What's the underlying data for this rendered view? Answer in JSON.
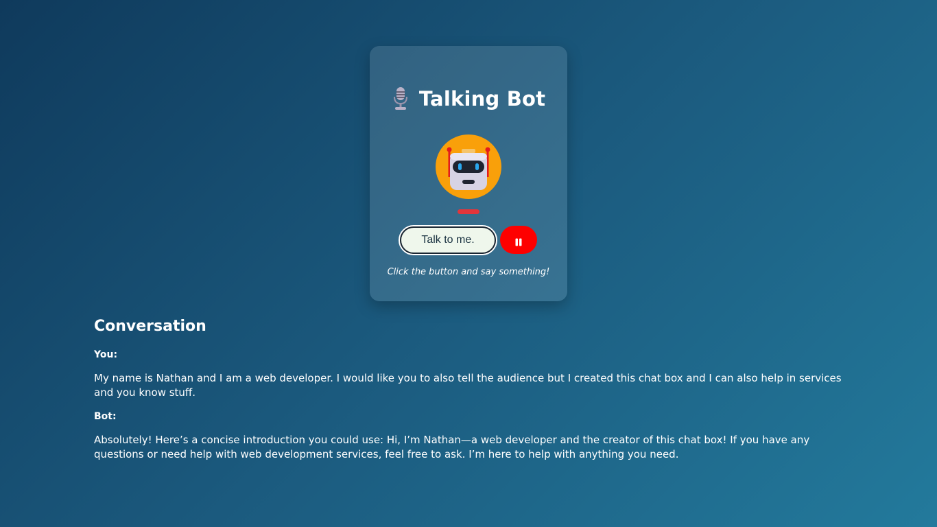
{
  "app": {
    "title": "Talking Bot",
    "hint": "Click the button and say something!"
  },
  "controls": {
    "talk_label": "Talk to me.",
    "pause_icon": "pause-icon"
  },
  "icons": {
    "title_icon": "microphone-icon",
    "avatar": "robot-icon"
  },
  "colors": {
    "avatar_bg": "#f9a00a",
    "indicator": "#e2353b",
    "pause_button": "#fe0000",
    "talk_button": "#eff7ec"
  },
  "conversation": {
    "title": "Conversation",
    "messages": [
      {
        "speaker": "You:",
        "text": "My name is Nathan and I am a web developer. I would like you to also tell the audience but I created this chat box and I can also help in services and you know stuff."
      },
      {
        "speaker": "Bot:",
        "text": "Absolutely! Here’s a concise introduction you could use: Hi, I’m Nathan—a web developer and the creator of this chat box! If you have any questions or need help with web development services, feel free to ask. I’m here to help with anything you need."
      }
    ]
  }
}
